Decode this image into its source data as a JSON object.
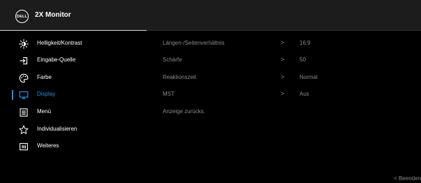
{
  "header": {
    "logo_text": "DELL",
    "title": "2X Monitor"
  },
  "menu": {
    "items": [
      {
        "label": "Helligkeit/Kontrast",
        "icon": "brightness-icon"
      },
      {
        "label": "Eingabe-Quelle",
        "icon": "input-source-icon"
      },
      {
        "label": "Farbe",
        "icon": "color-palette-icon"
      },
      {
        "label": "Display",
        "icon": "display-monitor-icon",
        "selected": true
      },
      {
        "label": "Menü",
        "icon": "menu-list-icon"
      },
      {
        "label": "Individualisieren",
        "icon": "star-icon"
      },
      {
        "label": "Weiteres",
        "icon": "info-icon"
      }
    ]
  },
  "submenu": {
    "rows": [
      {
        "label": "Längen-/Seitenverhältnis",
        "arrow": ">",
        "value": "16:9"
      },
      {
        "label": "Schärfe",
        "arrow": ">",
        "value": "50"
      },
      {
        "label": "Reaktionszeit",
        "arrow": ">",
        "value": "Normal"
      },
      {
        "label": "MST",
        "arrow": ">",
        "value": "Aus"
      },
      {
        "label": "Anzeige zurücks."
      }
    ]
  },
  "footer": {
    "exit_label": "< Beenden"
  },
  "colors": {
    "accent": "#2b8fd9",
    "header_bg": "#1c1c1c",
    "dim_text": "#8a8a8a",
    "background": "#000000"
  }
}
